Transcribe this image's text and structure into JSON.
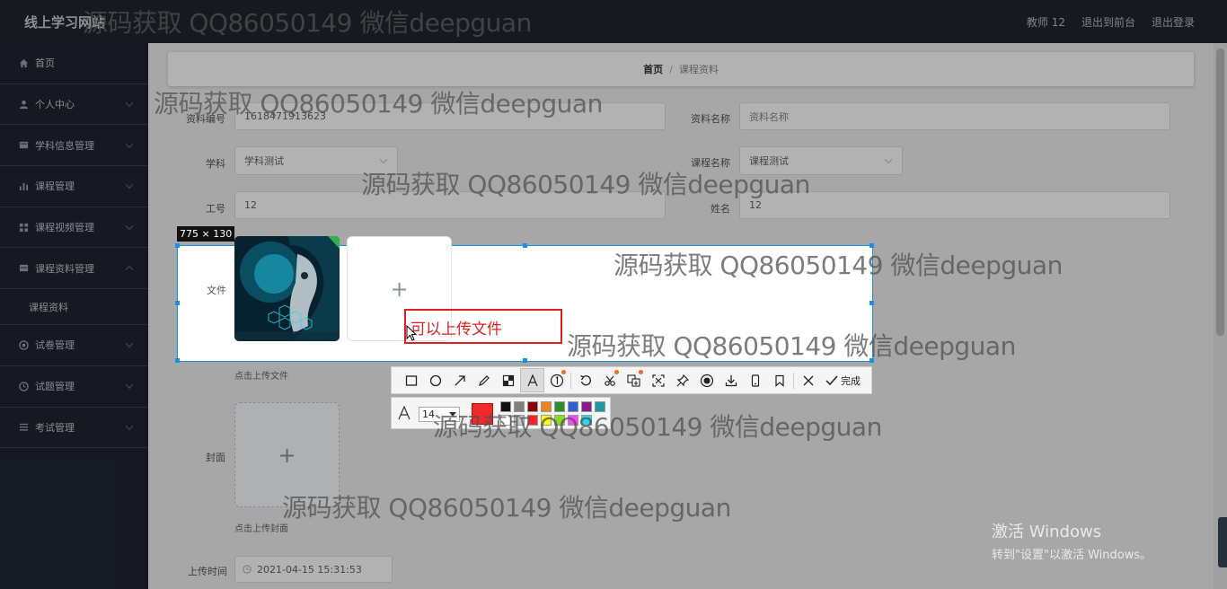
{
  "header": {
    "site_title": "线上学习网站",
    "user": "教师 12",
    "back_front": "退出到前台",
    "logout": "退出登录"
  },
  "sidebar": {
    "items": [
      {
        "label": "首页",
        "icon": "home-icon"
      },
      {
        "label": "个人中心",
        "icon": "user-icon"
      },
      {
        "label": "学科信息管理",
        "icon": "grid-icon"
      },
      {
        "label": "课程管理",
        "icon": "bar-chart-icon"
      },
      {
        "label": "课程视频管理",
        "icon": "grid-icon"
      },
      {
        "label": "课程资料管理",
        "icon": "grid-icon"
      },
      {
        "label": "试卷管理",
        "icon": "target-icon"
      },
      {
        "label": "试题管理",
        "icon": "clock-icon"
      },
      {
        "label": "考试管理",
        "icon": "list-icon"
      }
    ],
    "sub_item": "课程资料"
  },
  "breadcrumb": {
    "home": "首页",
    "separator": "/",
    "current": "课程资料"
  },
  "form": {
    "code_label": "资料编号",
    "code_value": "1618471913623",
    "name_label": "资料名称",
    "name_placeholder": "资料名称",
    "subject_label": "学科",
    "subject_value": "学科测试",
    "course_label": "课程名称",
    "course_value": "课程测试",
    "staff_label": "工号",
    "staff_value": "12",
    "person_label": "姓名",
    "person_value": "12",
    "file_label": "文件",
    "file_hint": "点击上传文件",
    "cover_label": "封面",
    "cover_hint": "点击上传封面",
    "time_label": "上传时间",
    "time_value": "2021-04-15 15:31:53",
    "plus": "+"
  },
  "capture": {
    "size_label": "775 × 130",
    "annotation_text": "可以上传文件",
    "done_label": "完成",
    "font_size": "14",
    "current_color": "#ee2a2a",
    "swatches": [
      "#111111",
      "#7f7f7f",
      "#8b0000",
      "#f0821e",
      "#2e8b2e",
      "#3060d0",
      "#8a1a8a",
      "#1a9a9a",
      "#ffffff",
      "#c8c8c8",
      "#ff2020",
      "#ffff00",
      "#88dd22",
      "#ff44ff",
      "#22ddee"
    ]
  },
  "watermark": "源码获取 QQ86050149 微信deepguan",
  "activation": {
    "line1": "激活 Windows",
    "line2": "转到\"设置\"以激活 Windows。"
  },
  "colors": {
    "topbar": "#21252f",
    "sidebar": "#202531",
    "accent": "#1a8fe3",
    "annotation": "#e02020"
  }
}
